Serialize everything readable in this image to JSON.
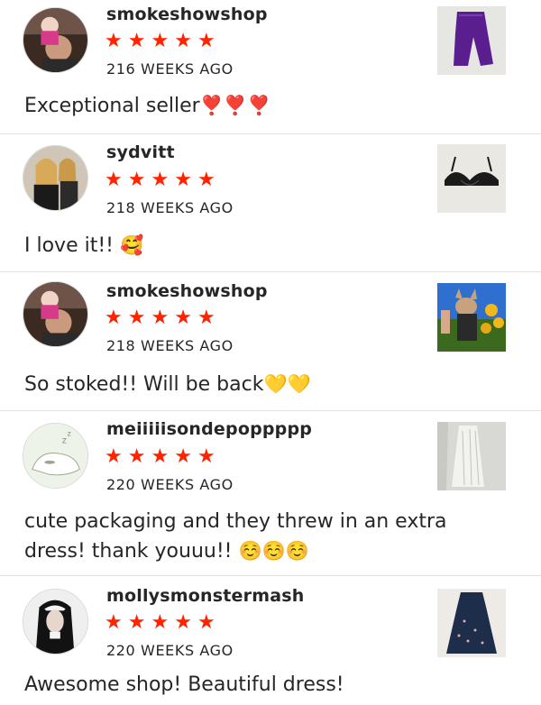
{
  "reviews": [
    {
      "username": "smokeshowshop",
      "rating": 5,
      "stars": [
        "★",
        "★",
        "★",
        "★",
        "★"
      ],
      "timestamp": "216 WEEKS AGO",
      "comment": "Exceptional seller",
      "emoji": "❣️❣️❣️",
      "avatar_icon": "person-holding-child-avatar",
      "thumbnail_icon": "purple-leggings-thumbnail"
    },
    {
      "username": "sydvitt",
      "rating": 5,
      "stars": [
        "★",
        "★",
        "★",
        "★",
        "★"
      ],
      "timestamp": "218 WEEKS AGO",
      "comment": "I love it!!",
      "emoji": "🥰",
      "avatar_icon": "mirror-selfie-avatar",
      "thumbnail_icon": "black-bra-thumbnail"
    },
    {
      "username": "smokeshowshop",
      "rating": 5,
      "stars": [
        "★",
        "★",
        "★",
        "★",
        "★"
      ],
      "timestamp": "218 WEEKS AGO",
      "comment": "So stoked!! Will be back",
      "emoji": "💛💛",
      "avatar_icon": "person-holding-child-avatar",
      "thumbnail_icon": "dog-in-flowers-thumbnail"
    },
    {
      "username": "meiiiiisondepoppppp",
      "rating": 5,
      "stars": [
        "★",
        "★",
        "★",
        "★",
        "★"
      ],
      "timestamp": "220 WEEKS AGO",
      "comment": "cute packaging and they threw in an extra dress! thank youuu!!",
      "emoji": "☺️☺️☺️",
      "avatar_icon": "sleeping-cartoon-avatar",
      "thumbnail_icon": "white-dress-thumbnail"
    },
    {
      "username": "mollysmonstermash",
      "rating": 5,
      "stars": [
        "★",
        "★",
        "★",
        "★",
        "★"
      ],
      "timestamp": "220 WEEKS AGO",
      "comment": "Awesome shop! Beautiful dress!",
      "emoji": "",
      "avatar_icon": "nun-portrait-avatar",
      "thumbnail_icon": "navy-dress-thumbnail"
    }
  ],
  "colors": {
    "star": "#ff2300",
    "text": "#262626",
    "divider": "#e2e2e2"
  }
}
